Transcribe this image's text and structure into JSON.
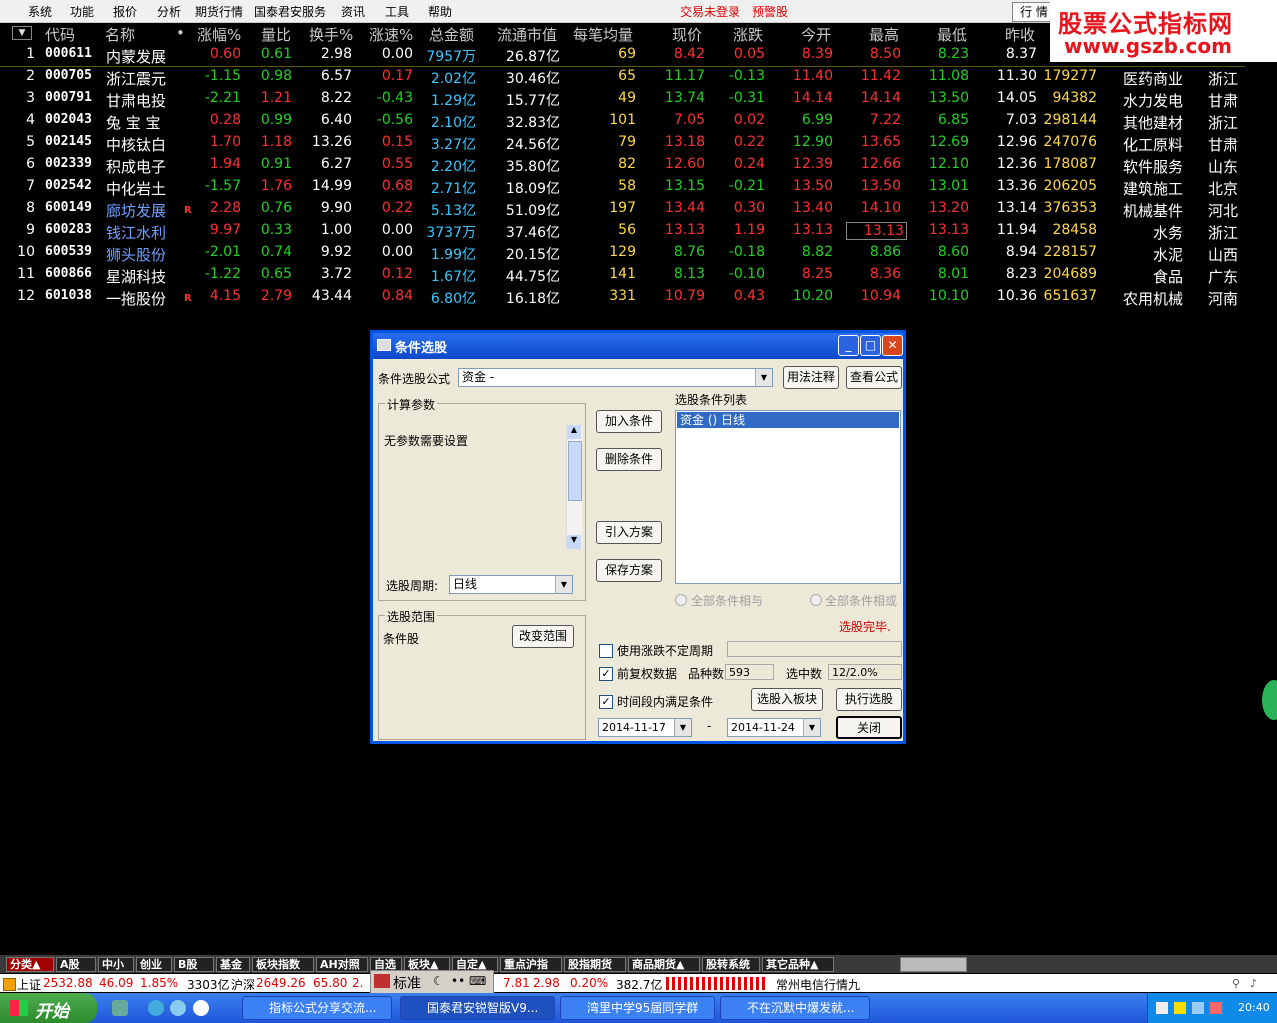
{
  "menu": {
    "items": [
      "系统",
      "功能",
      "报价",
      "分析",
      "期货行情",
      "国泰君安服务",
      "资讯",
      "工具",
      "帮助"
    ],
    "status_login": "交易未登录",
    "status_alert": "预警股",
    "right_btn": "行 情"
  },
  "watermark": {
    "line1": "股票公式指标网",
    "line2": "www.gszb.com"
  },
  "table": {
    "headers": [
      "代码",
      "名称",
      "•",
      "涨幅%",
      "量比",
      "换手%",
      "涨速%",
      "总金额",
      "流通市值",
      "每笔均量",
      "现价",
      "涨跌",
      "今开",
      "最高",
      "最低",
      "昨收"
    ],
    "rows": [
      {
        "n": "1",
        "code": "000611",
        "name": "内蒙发展",
        "chg": "0.60",
        "lb": "0.61",
        "hs": "2.98",
        "zs": "0.00",
        "amt": "7957万",
        "mv": "26.87亿",
        "avg": "69",
        "price": "8.42",
        "diff": "0.05",
        "open": "8.39",
        "high": "8.50",
        "low": "8.23",
        "prev": "8.37",
        "vol": "",
        "ind": "",
        "reg": ""
      },
      {
        "n": "2",
        "code": "000705",
        "name": "浙江震元",
        "chg": "-1.15",
        "lb": "0.98",
        "hs": "6.57",
        "zs": "0.17",
        "amt": "2.02亿",
        "mv": "30.46亿",
        "avg": "65",
        "price": "11.17",
        "diff": "-0.13",
        "open": "11.40",
        "high": "11.42",
        "low": "11.08",
        "prev": "11.30",
        "vol": "179277",
        "ind": "医药商业",
        "reg": "浙江"
      },
      {
        "n": "3",
        "code": "000791",
        "name": "甘肃电投",
        "chg": "-2.21",
        "lb": "1.21",
        "hs": "8.22",
        "zs": "-0.43",
        "amt": "1.29亿",
        "mv": "15.77亿",
        "avg": "49",
        "price": "13.74",
        "diff": "-0.31",
        "open": "14.14",
        "high": "14.14",
        "low": "13.50",
        "prev": "14.05",
        "vol": "94382",
        "ind": "水力发电",
        "reg": "甘肃"
      },
      {
        "n": "4",
        "code": "002043",
        "name": "兔 宝 宝",
        "chg": "0.28",
        "lb": "0.99",
        "hs": "6.40",
        "zs": "-0.56",
        "amt": "2.10亿",
        "mv": "32.83亿",
        "avg": "101",
        "price": "7.05",
        "diff": "0.02",
        "open": "6.99",
        "high": "7.22",
        "low": "6.85",
        "prev": "7.03",
        "vol": "298144",
        "ind": "其他建材",
        "reg": "浙江"
      },
      {
        "n": "5",
        "code": "002145",
        "name": "中核钛白",
        "chg": "1.70",
        "lb": "1.18",
        "hs": "13.26",
        "zs": "0.15",
        "amt": "3.27亿",
        "mv": "24.56亿",
        "avg": "79",
        "price": "13.18",
        "diff": "0.22",
        "open": "12.90",
        "high": "13.65",
        "low": "12.69",
        "prev": "12.96",
        "vol": "247076",
        "ind": "化工原料",
        "reg": "甘肃"
      },
      {
        "n": "6",
        "code": "002339",
        "name": "积成电子",
        "chg": "1.94",
        "lb": "0.91",
        "hs": "6.27",
        "zs": "0.55",
        "amt": "2.20亿",
        "mv": "35.80亿",
        "avg": "82",
        "price": "12.60",
        "diff": "0.24",
        "open": "12.39",
        "high": "12.66",
        "low": "12.10",
        "prev": "12.36",
        "vol": "178087",
        "ind": "软件服务",
        "reg": "山东"
      },
      {
        "n": "7",
        "code": "002542",
        "name": "中化岩土",
        "chg": "-1.57",
        "lb": "1.76",
        "hs": "14.99",
        "zs": "0.68",
        "amt": "2.71亿",
        "mv": "18.09亿",
        "avg": "58",
        "price": "13.15",
        "diff": "-0.21",
        "open": "13.50",
        "high": "13.50",
        "low": "13.01",
        "prev": "13.36",
        "vol": "206205",
        "ind": "建筑施工",
        "reg": "北京"
      },
      {
        "n": "8",
        "code": "600149",
        "name": "廊坊发展",
        "flag": "R",
        "chg": "2.28",
        "lb": "0.76",
        "hs": "9.90",
        "zs": "0.22",
        "amt": "5.13亿",
        "mv": "51.09亿",
        "avg": "197",
        "price": "13.44",
        "diff": "0.30",
        "open": "13.40",
        "high": "14.10",
        "low": "13.20",
        "prev": "13.14",
        "vol": "376353",
        "ind": "机械基件",
        "reg": "河北"
      },
      {
        "n": "9",
        "code": "600283",
        "name": "钱江水利",
        "chg": "9.97",
        "lb": "0.33",
        "hs": "1.00",
        "zs": "0.00",
        "amt": "3737万",
        "mv": "37.46亿",
        "avg": "56",
        "price": "13.13",
        "diff": "1.19",
        "open": "13.13",
        "high": "13.13",
        "low": "13.13",
        "prev": "11.94",
        "vol": "28458",
        "ind": "水务",
        "reg": "浙江"
      },
      {
        "n": "10",
        "code": "600539",
        "name": "狮头股份",
        "chg": "-2.01",
        "lb": "0.74",
        "hs": "9.92",
        "zs": "0.00",
        "amt": "1.99亿",
        "mv": "20.15亿",
        "avg": "129",
        "price": "8.76",
        "diff": "-0.18",
        "open": "8.82",
        "high": "8.86",
        "low": "8.60",
        "prev": "8.94",
        "vol": "228157",
        "ind": "水泥",
        "reg": "山西"
      },
      {
        "n": "11",
        "code": "600866",
        "name": "星湖科技",
        "chg": "-1.22",
        "lb": "0.65",
        "hs": "3.72",
        "zs": "0.12",
        "amt": "1.67亿",
        "mv": "44.75亿",
        "avg": "141",
        "price": "8.13",
        "diff": "-0.10",
        "open": "8.25",
        "high": "8.36",
        "low": "8.01",
        "prev": "8.23",
        "vol": "204689",
        "ind": "食品",
        "reg": "广东"
      },
      {
        "n": "12",
        "code": "601038",
        "name": "一拖股份",
        "flag": "R",
        "chg": "4.15",
        "lb": "2.79",
        "hs": "43.44",
        "zs": "0.84",
        "amt": "6.80亿",
        "mv": "16.18亿",
        "avg": "331",
        "price": "10.79",
        "diff": "0.43",
        "open": "10.20",
        "high": "10.94",
        "low": "10.10",
        "prev": "10.36",
        "vol": "651637",
        "ind": "农用机械",
        "reg": "河南"
      }
    ]
  },
  "dialog": {
    "title": "条件选股",
    "formula_label": "条件选股公式",
    "formula_value": "资金        -",
    "usage_btn": "用法注释",
    "view_btn": "查看公式",
    "params_title": "计算参数",
    "params_text": "无参数需要设置",
    "period_label": "选股周期:",
    "period_value": "日线",
    "range_title": "选股范围",
    "range_text": "条件股",
    "change_range_btn": "改变范围",
    "add_btn": "加入条件",
    "delete_btn": "删除条件",
    "import_btn": "引入方案",
    "save_btn": "保存方案",
    "list_title": "选股条件列表",
    "list_item": "资金  () 日线",
    "radio_and": "全部条件相与",
    "radio_or": "全部条件相或",
    "done_text": "选股完毕.",
    "chk_period": "使用涨跌不定周期",
    "chk_fq": "前复权数据",
    "species_label": "品种数",
    "species_value": "593",
    "selected_label": "选中数",
    "selected_value": "12/2.0%",
    "chk_range": "时间段内满足条件",
    "to_block_btn": "选股入板块",
    "run_btn": "执行选股",
    "date_from": "2014-11-17",
    "date_sep": "-",
    "date_to": "2014-11-24",
    "close_btn": "关闭"
  },
  "tabs": [
    "分类▲",
    "A股",
    "中小",
    "创业",
    "B股",
    "基金",
    "板块指数",
    "AH对照",
    "自选",
    "板块▲",
    "自定▲",
    "重点沪指",
    "股指期货",
    "商品期货▲",
    "股转系统",
    "其它品种▲"
  ],
  "status": {
    "sh_label": "上证",
    "sh_val": "2532.88",
    "sh_chg": "46.09",
    "sh_pct": "1.85%",
    "sh_amt": "3303亿",
    "hs_label": "沪深",
    "hs_val": "2649.26",
    "hs_chg": "65.80",
    "hs_x": "2.",
    "mid1": "7.81",
    "mid2": "2.98",
    "mid3": "0.20%",
    "mid4": "382.7亿",
    "ticker": "常州电信行情九",
    "float_tool": "标准"
  },
  "taskbar": {
    "start": "开始",
    "tasks": [
      "指标公式分享交流...",
      "国泰君安锐智版V9...",
      "湾里中学95届同学群",
      "不在沉默中爆发就..."
    ],
    "clock": "20:40"
  },
  "colors": {
    "up": "#ff3030",
    "down": "#22d022",
    "title_blue": "#0a48c8"
  }
}
